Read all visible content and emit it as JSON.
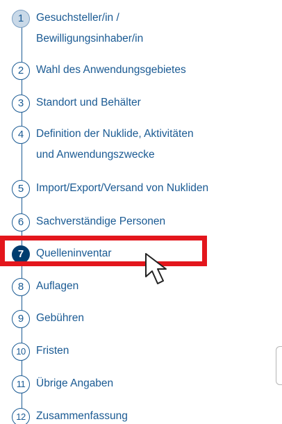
{
  "steps": [
    {
      "number": "1",
      "lines": [
        "Gesuchsteller/in /",
        "Bewilligungsinhaber/in"
      ],
      "state": "done"
    },
    {
      "number": "2",
      "lines": [
        "Wahl des Anwendungsgebietes"
      ],
      "state": "default"
    },
    {
      "number": "3",
      "lines": [
        "Standort und Behälter"
      ],
      "state": "default"
    },
    {
      "number": "4",
      "lines": [
        "Definition der Nuklide, Aktivitäten",
        "und Anwendungszwecke"
      ],
      "state": "default"
    },
    {
      "number": "5",
      "lines": [
        "Import/Export/Versand von Nukliden"
      ],
      "state": "default"
    },
    {
      "number": "6",
      "lines": [
        "Sachverständige Personen"
      ],
      "state": "default"
    },
    {
      "number": "7",
      "lines": [
        "Quelleninventar"
      ],
      "state": "current"
    },
    {
      "number": "8",
      "lines": [
        "Auflagen"
      ],
      "state": "default"
    },
    {
      "number": "9",
      "lines": [
        "Gebühren"
      ],
      "state": "default"
    },
    {
      "number": "10",
      "lines": [
        "Fristen"
      ],
      "state": "default"
    },
    {
      "number": "11",
      "lines": [
        "Übrige Angaben"
      ],
      "state": "default"
    },
    {
      "number": "12",
      "lines": [
        "Zusammenfassung"
      ],
      "state": "default"
    }
  ],
  "colors": {
    "step_text": "#1a5a93",
    "current_fill": "#003d6f",
    "done_fill": "#c9d9e8",
    "highlight": "#e3161c"
  },
  "icons": {
    "pointer": "mouse-pointer-icon"
  }
}
